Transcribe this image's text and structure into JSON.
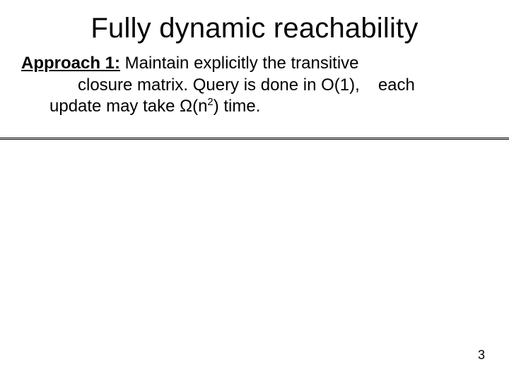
{
  "title": "Fully dynamic reachability",
  "approach_label": "Approach 1:",
  "line1_rest": " Maintain explicitly the transitive",
  "line2_part1": "closure matrix. Query is done in O(1),",
  "line2_part2": "each",
  "line3_pre": "update may take ",
  "line3_omega": "Ω",
  "line3_open": "(n",
  "line3_exp": "2",
  "line3_close": ") time.",
  "page_number": "3"
}
